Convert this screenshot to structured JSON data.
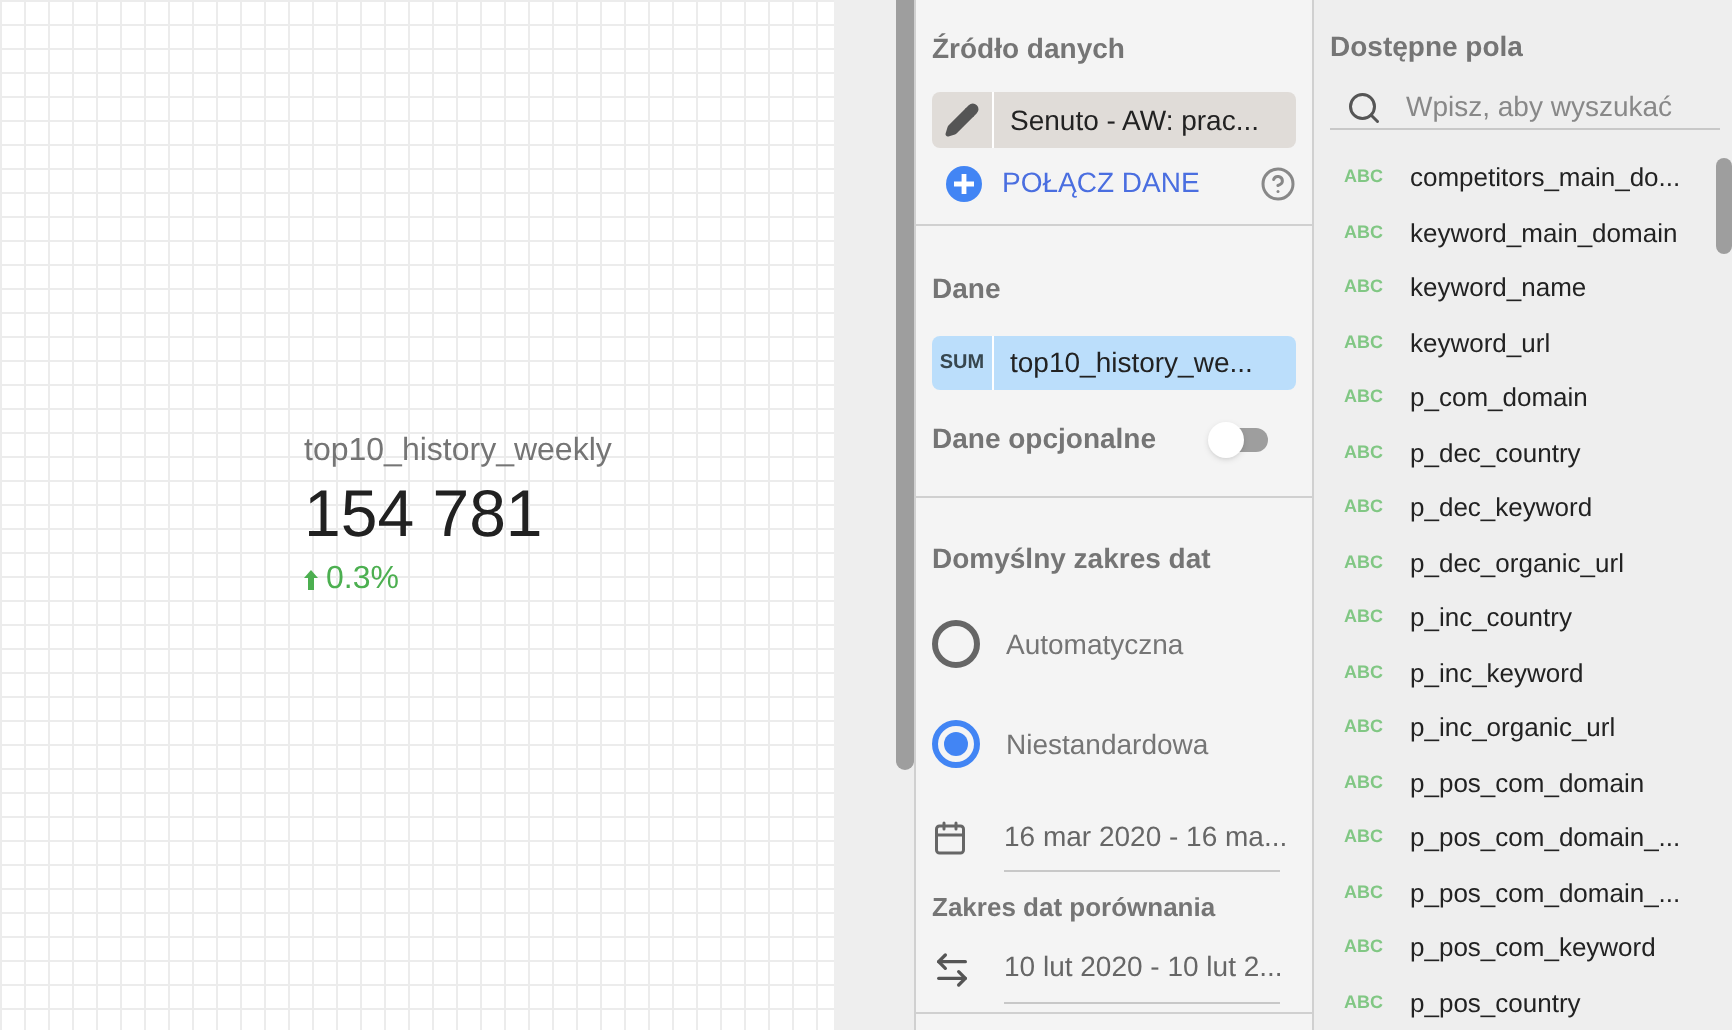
{
  "scorecard": {
    "title": "top10_history_weekly",
    "value": "154 781",
    "change": "0.3%",
    "increase": true
  },
  "data_source": {
    "heading": "Źródło danych",
    "source": "Senuto - AW: prac...",
    "connect": "POŁĄCZ DANE"
  },
  "metric": {
    "heading": "Dane",
    "aggregation": "SUM",
    "field": "top10_history_we...",
    "optional_label": "Dane opcjonalne",
    "optional_on": false
  },
  "date_range": {
    "heading": "Domyślny zakres dat",
    "options": [
      {
        "label": "Automatyczna",
        "selected": false
      },
      {
        "label": "Niestandardowa",
        "selected": true
      }
    ],
    "range": "16 mar 2020 - 16 ma...",
    "comparison_heading": "Zakres dat porównania",
    "comparison": "10 lut 2020 - 10 lut 2..."
  },
  "available_fields": {
    "heading": "Dostępne pola",
    "search_placeholder": "Wpisz, aby wyszukać",
    "fields": [
      {
        "type": "ABC",
        "name": "competitors_main_do..."
      },
      {
        "type": "ABC",
        "name": "keyword_main_domain"
      },
      {
        "type": "ABC",
        "name": "keyword_name"
      },
      {
        "type": "ABC",
        "name": "keyword_url"
      },
      {
        "type": "ABC",
        "name": "p_com_domain"
      },
      {
        "type": "ABC",
        "name": "p_dec_country"
      },
      {
        "type": "ABC",
        "name": "p_dec_keyword"
      },
      {
        "type": "ABC",
        "name": "p_dec_organic_url"
      },
      {
        "type": "ABC",
        "name": "p_inc_country"
      },
      {
        "type": "ABC",
        "name": "p_inc_keyword"
      },
      {
        "type": "ABC",
        "name": "p_inc_organic_url"
      },
      {
        "type": "ABC",
        "name": "p_pos_com_domain"
      },
      {
        "type": "ABC",
        "name": "p_pos_com_domain_..."
      },
      {
        "type": "ABC",
        "name": "p_pos_com_domain_..."
      },
      {
        "type": "ABC",
        "name": "p_pos_com_keyword"
      },
      {
        "type": "ABC",
        "name": "p_pos_country"
      }
    ]
  }
}
